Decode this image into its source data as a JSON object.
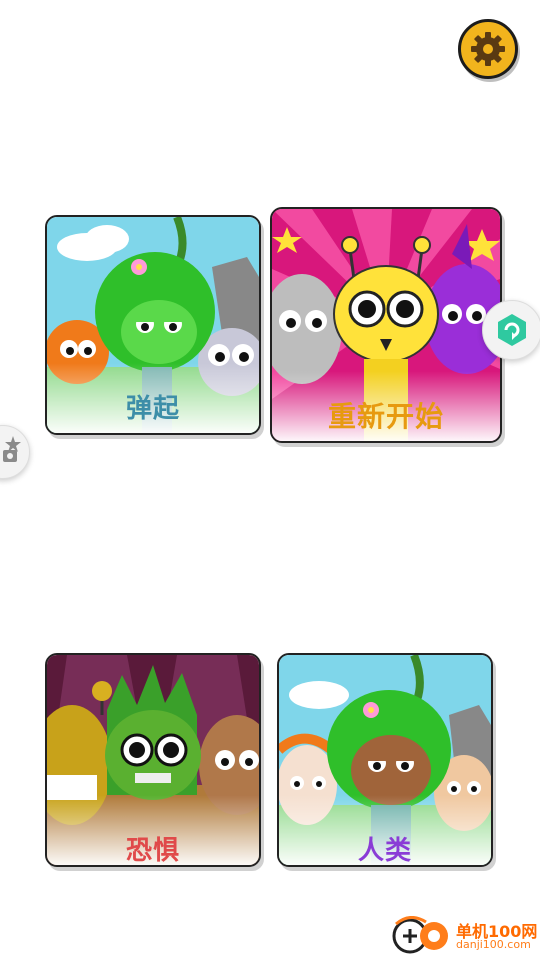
{
  "settings_button": {
    "icon": "gear-icon",
    "color": "#f2b41d"
  },
  "side_right_button": {
    "icon": "refresh-badge-icon"
  },
  "side_left_button": {
    "icon": "star-camera-icon"
  },
  "cards": [
    {
      "label": "弹起",
      "label_color": "#3d8ea8"
    },
    {
      "label": "重新开始",
      "label_color": "#e79a10"
    },
    {
      "label": "恐惧",
      "label_color": "#e04a4a"
    },
    {
      "label": "人类",
      "label_color": "#8a3cd6"
    }
  ],
  "watermark": {
    "line1": "单机100网",
    "line2": "danji100.com"
  }
}
